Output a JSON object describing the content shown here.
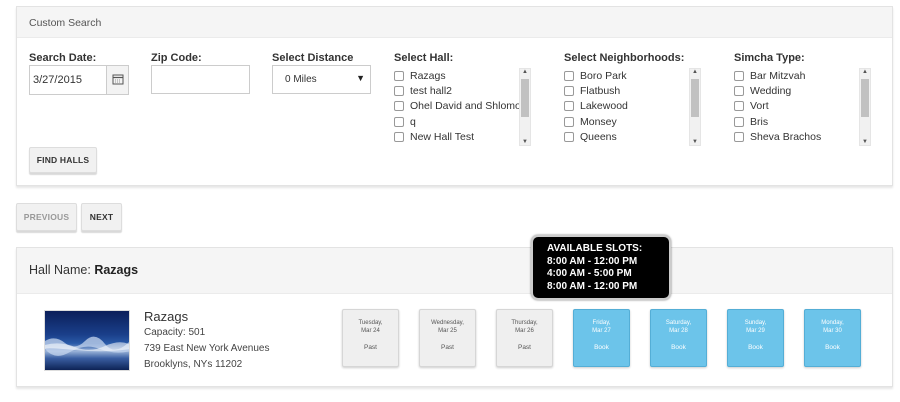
{
  "search": {
    "title": "Custom Search",
    "date_label": "Search Date:",
    "date_value": "3/27/2015",
    "zip_label": "Zip Code:",
    "zip_value": "",
    "distance_label": "Select Distance",
    "distance_value": "0 Miles",
    "hall_label": "Select Hall:",
    "halls": [
      "Razags",
      "test hall2",
      "Ohel David and Shlomo",
      "q",
      "New Hall Test"
    ],
    "neighborhood_label": "Select Neighborhoods:",
    "neighborhoods": [
      "Boro Park",
      "Flatbush",
      "Lakewood",
      "Monsey",
      "Queens"
    ],
    "simcha_label": "Simcha Type:",
    "simchas": [
      "Bar Mitzvah",
      "Wedding",
      "Vort",
      "Bris",
      "Sheva Brachos"
    ],
    "find_button": "FIND HALLS"
  },
  "pager": {
    "previous": "PREVIOUS",
    "next": "NEXT"
  },
  "hall": {
    "header_prefix": "Hall Name:",
    "header_name": "Razags",
    "name": "Razags",
    "capacity": "Capacity: 501",
    "address1": "739 East New York Avenues",
    "address2": "Brooklyns, NYs 11202"
  },
  "days": [
    {
      "name": "Tuesday,",
      "date": "Mar 24",
      "status": "Past",
      "state": "past"
    },
    {
      "name": "Wednesday,",
      "date": "Mar 25",
      "status": "Past",
      "state": "past"
    },
    {
      "name": "Thursday,",
      "date": "Mar 26",
      "status": "Past",
      "state": "past"
    },
    {
      "name": "Friday,",
      "date": "Mar 27",
      "status": "Book",
      "state": "book"
    },
    {
      "name": "Saturday,",
      "date": "Mar 28",
      "status": "Book",
      "state": "book"
    },
    {
      "name": "Sunday,",
      "date": "Mar 29",
      "status": "Book",
      "state": "book"
    },
    {
      "name": "Monday,",
      "date": "Mar 30",
      "status": "Book",
      "state": "book"
    }
  ],
  "tooltip": {
    "title": "AVAILABLE SLOTS:",
    "slots": [
      "8:00 AM - 12:00 PM",
      "4:00 AM - 5:00 PM",
      "8:00 AM - 12:00 PM"
    ]
  },
  "colors": {
    "book": "#6cc4ea",
    "past": "#efefef",
    "tooltip_bg": "#000000"
  }
}
